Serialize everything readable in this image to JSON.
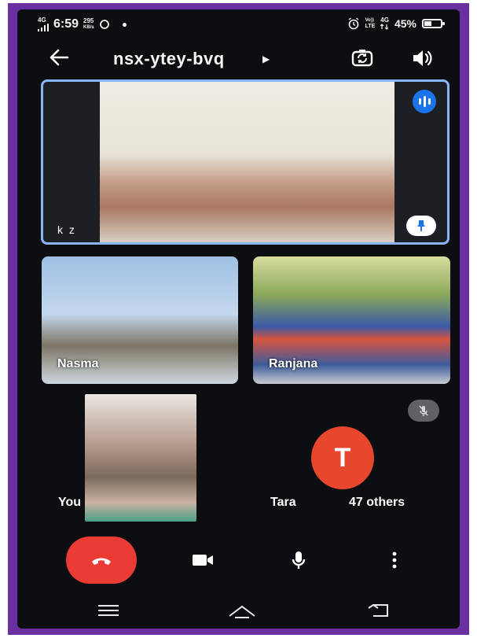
{
  "status_bar": {
    "network_type": "4G",
    "time": "6:59",
    "speed_value": "295",
    "speed_unit": "KB/s",
    "carrier_label_1": "Vo))",
    "carrier_label_2": "LTE",
    "network_right": "4G",
    "battery": "45%",
    "battery_level": 0.45
  },
  "header": {
    "meeting_code": "nsx-ytey-bvq",
    "back_icon": "arrow-left-icon",
    "camera_switch_icon": "camera-flip-icon",
    "speaker_icon": "speaker-icon"
  },
  "main_tile": {
    "participant": "k z"
  },
  "tiles": [
    {
      "participant": "Nasma"
    },
    {
      "participant": "Ranjana"
    }
  ],
  "self_tile": {
    "participant": "You"
  },
  "avatar_tile": {
    "initial": "T",
    "participant": "Tara",
    "color": "#e8472e"
  },
  "others_label": "47 others",
  "colors": {
    "end_call": "#ea3c35",
    "speaking_indicator": "#1a73e8",
    "active_border": "#8ab4f8",
    "frame": "#6a2fa0"
  },
  "controls": [
    "end-call-icon",
    "video-icon",
    "mic-icon",
    "more-vert-icon"
  ],
  "nav": [
    "menu-icon",
    "home-icon",
    "back-icon"
  ]
}
